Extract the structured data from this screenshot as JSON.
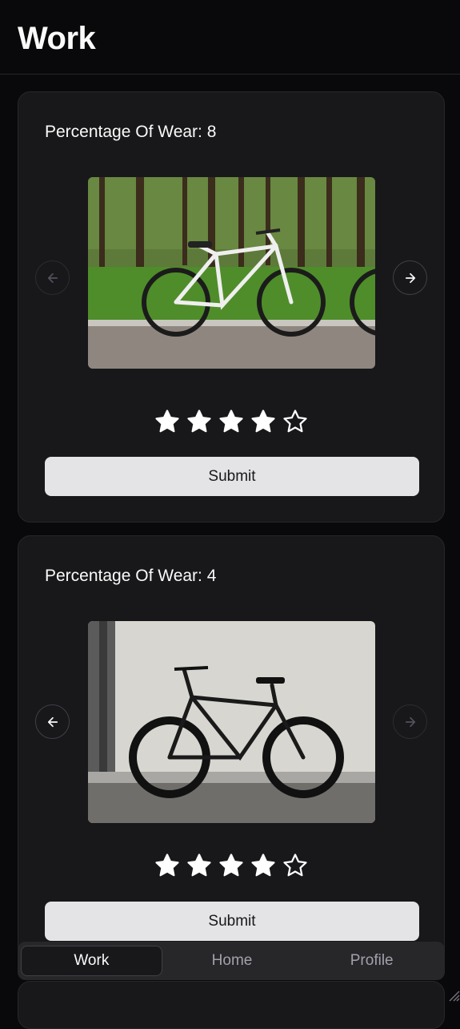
{
  "header": {
    "title": "Work"
  },
  "cards": [
    {
      "title": "Percentage Of Wear: 8",
      "rating": 4,
      "max_rating": 5,
      "submit_label": "Submit",
      "prev_disabled": true,
      "next_disabled": false
    },
    {
      "title": "Percentage Of Wear: 4",
      "rating": 4,
      "max_rating": 5,
      "submit_label": "Submit",
      "prev_disabled": false,
      "next_disabled": true
    }
  ],
  "bottom_nav": {
    "tabs": [
      {
        "label": "Work",
        "active": true
      },
      {
        "label": "Home",
        "active": false
      },
      {
        "label": "Profile",
        "active": false
      }
    ]
  },
  "colors": {
    "background": "#09090b",
    "card": "#18181b",
    "border": "#27272a",
    "button": "#e4e4e7",
    "star": "#ffffff"
  }
}
